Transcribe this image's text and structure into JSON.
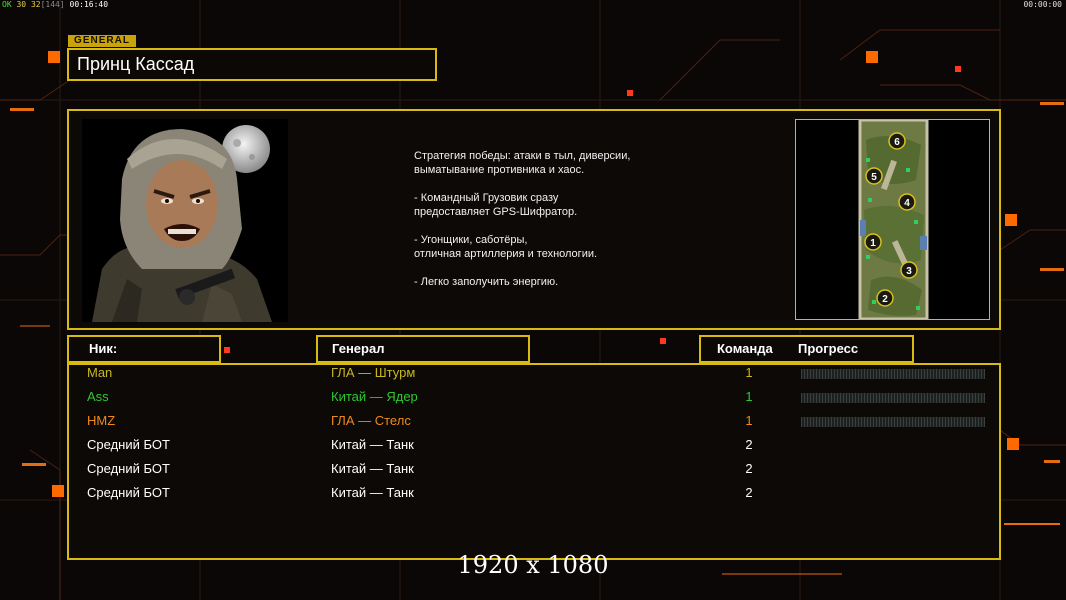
{
  "hud": {
    "ok": "OK",
    "fps_a": "30",
    "fps_b": "32",
    "fps_c": "[144]",
    "time_left": "00:16:40",
    "time_right": "00:00:00"
  },
  "general": {
    "tag": "GENERAL",
    "name": "Принц Кассад"
  },
  "description": [
    "Стратегия победы: атаки в тыл, диверсии,\n выматывание противника и хаос.",
    "- Командный Грузовик сразу\nпредоставляет GPS-Шифратор.",
    "- Угонщики, саботёры,\nотличная артиллерия и технологии.",
    "- Легко заполучить энергию."
  ],
  "map": {
    "start_positions": [
      "6",
      "5",
      "4",
      "1",
      "3",
      "2"
    ]
  },
  "table": {
    "headers": {
      "nick": "Ник:",
      "general": "Генерал",
      "team": "Команда",
      "progress": "Прогресс"
    },
    "rows": [
      {
        "nick": "Man",
        "general": "ГЛА — Штурм",
        "team": "1",
        "color": "#c8b820",
        "show_progress": true
      },
      {
        "nick": "Ass",
        "general": "Китай — Ядер",
        "team": "1",
        "color": "#2ec830",
        "show_progress": true
      },
      {
        "nick": "HMZ",
        "general": "ГЛА — Стелс",
        "team": "1",
        "color": "#ee8a1c",
        "show_progress": true
      },
      {
        "nick": "Средний БОТ",
        "general": "Китай — Танк",
        "team": "2",
        "color": "#ffffff",
        "show_progress": false
      },
      {
        "nick": "Средний БОТ",
        "general": "Китай — Танк",
        "team": "2",
        "color": "#ffffff",
        "show_progress": false
      },
      {
        "nick": "Средний БОТ",
        "general": "Китай — Танк",
        "team": "2",
        "color": "#ffffff",
        "show_progress": false
      }
    ]
  },
  "overlay": {
    "resolution": "1920 x 1080"
  },
  "colors": {
    "accent": "#d8bb10",
    "background": "#0b0706",
    "deco_orange": "#ff6a00"
  }
}
